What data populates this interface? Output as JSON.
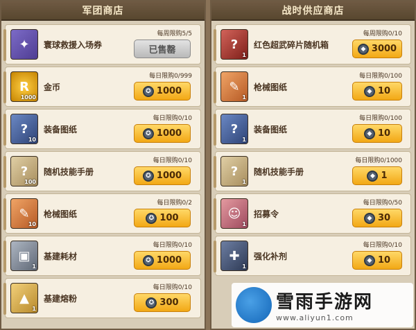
{
  "left_panel": {
    "title": "军团商店",
    "items": [
      {
        "name": "寰球救援入场券",
        "limit": "每周限购5/5",
        "price": "已售罄",
        "count": "",
        "icon": "ticket-icon",
        "sold": true
      },
      {
        "name": "金币",
        "limit": "每日限购0/999",
        "price": "1000",
        "count": "1000",
        "icon": "gold-coin-icon",
        "sold": false
      },
      {
        "name": "装备图纸",
        "limit": "每日限购0/10",
        "price": "1000",
        "count": "10",
        "icon": "equipment-blueprint-icon",
        "sold": false
      },
      {
        "name": "随机技能手册",
        "limit": "每日限购0/10",
        "price": "1000",
        "count": "100",
        "icon": "skill-manual-icon",
        "sold": false
      },
      {
        "name": "枪械图纸",
        "limit": "每日限购0/2",
        "price": "100",
        "count": "10",
        "icon": "firearm-blueprint-icon",
        "sold": false
      },
      {
        "name": "基建耗材",
        "limit": "每日限购0/10",
        "price": "1000",
        "count": "1",
        "icon": "construction-material-icon",
        "sold": false
      },
      {
        "name": "基建熔粉",
        "limit": "每日限购0/10",
        "price": "300",
        "count": "1",
        "icon": "construction-powder-icon",
        "sold": false
      }
    ]
  },
  "right_panel": {
    "title": "战时供应商店",
    "items": [
      {
        "name": "红色超武碎片随机箱",
        "limit": "每周限购0/10",
        "price": "3000",
        "count": "1",
        "icon": "red-weapon-box-icon"
      },
      {
        "name": "枪械图纸",
        "limit": "每日限购0/100",
        "price": "10",
        "count": "1",
        "icon": "firearm-blueprint-icon"
      },
      {
        "name": "装备图纸",
        "limit": "每日限购0/100",
        "price": "10",
        "count": "1",
        "icon": "equipment-blueprint-icon"
      },
      {
        "name": "随机技能手册",
        "limit": "每日限购0/1000",
        "price": "1",
        "count": "1",
        "icon": "skill-manual-icon"
      },
      {
        "name": "招募令",
        "limit": "每日限购0/50",
        "price": "30",
        "count": "1",
        "icon": "recruit-order-icon"
      },
      {
        "name": "强化补剂",
        "limit": "每日限购0/10",
        "price": "10",
        "count": "1",
        "icon": "syringe-icon"
      }
    ]
  },
  "watermark": {
    "title": "雪雨手游网",
    "url": "www.aliyun1.com"
  }
}
